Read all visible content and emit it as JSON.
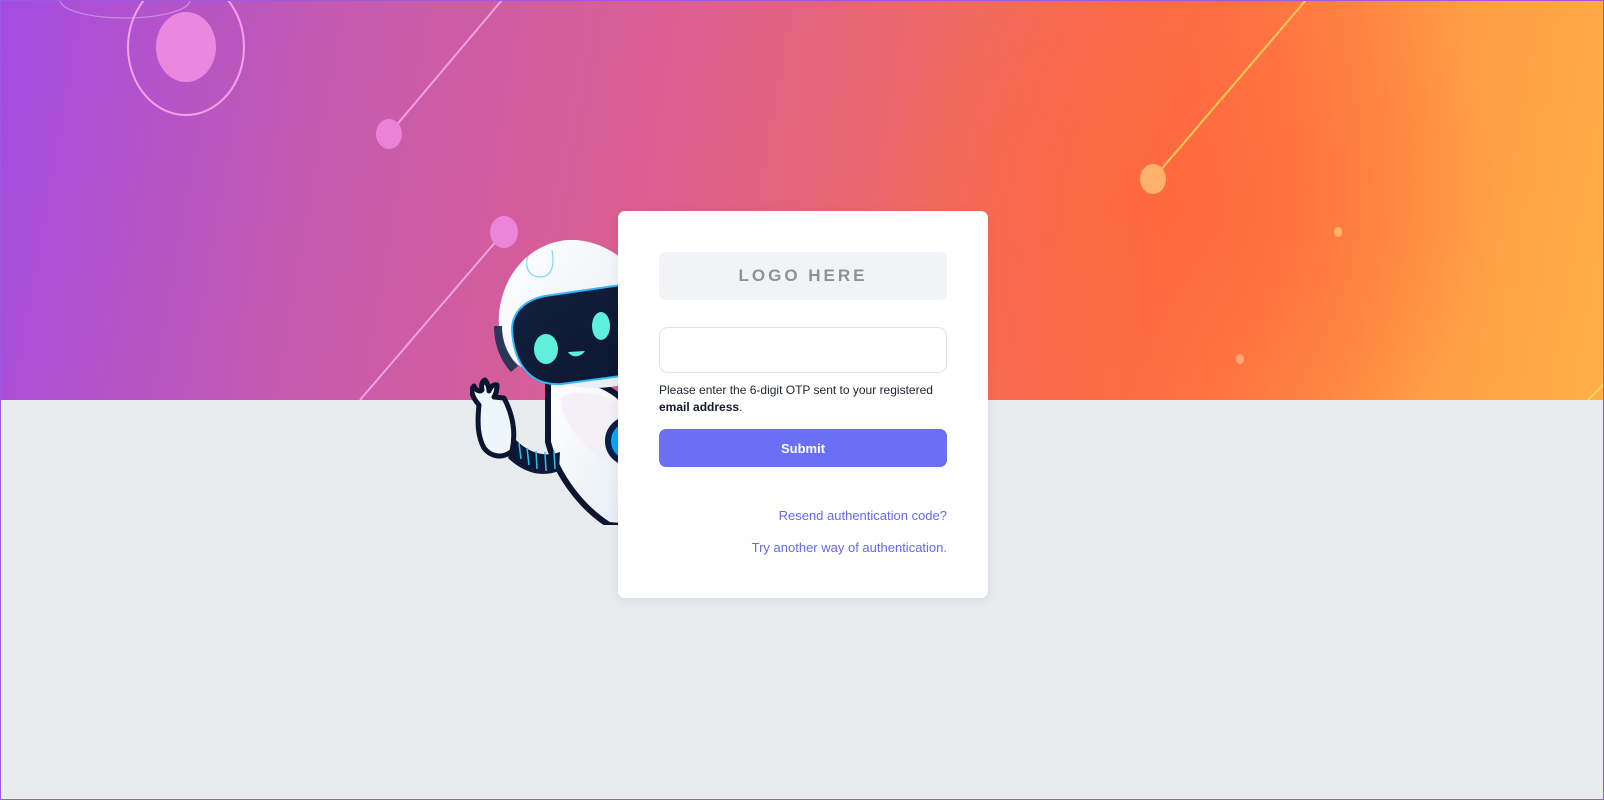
{
  "login_card": {
    "logo_text": "LOGO HERE",
    "otp_input": {
      "value": "",
      "placeholder": ""
    },
    "instruction_before": "Please enter the 6-digit OTP sent to your registered ",
    "instruction_emphasis": "email address",
    "instruction_after": ".",
    "submit_label": "Submit",
    "resend_link": "Resend authentication code?",
    "alternate_link": "Try another way of authentication."
  },
  "colors": {
    "page_background": "#e7ebee",
    "button_primary": "#6b6ff6",
    "link": "#6468f2",
    "text_primary": "#1d2230",
    "hero_gradient_start": "#a44ce3",
    "hero_gradient_end": "#ffb047"
  },
  "illustrations": {
    "mascot": "robot-mascot-icon"
  }
}
